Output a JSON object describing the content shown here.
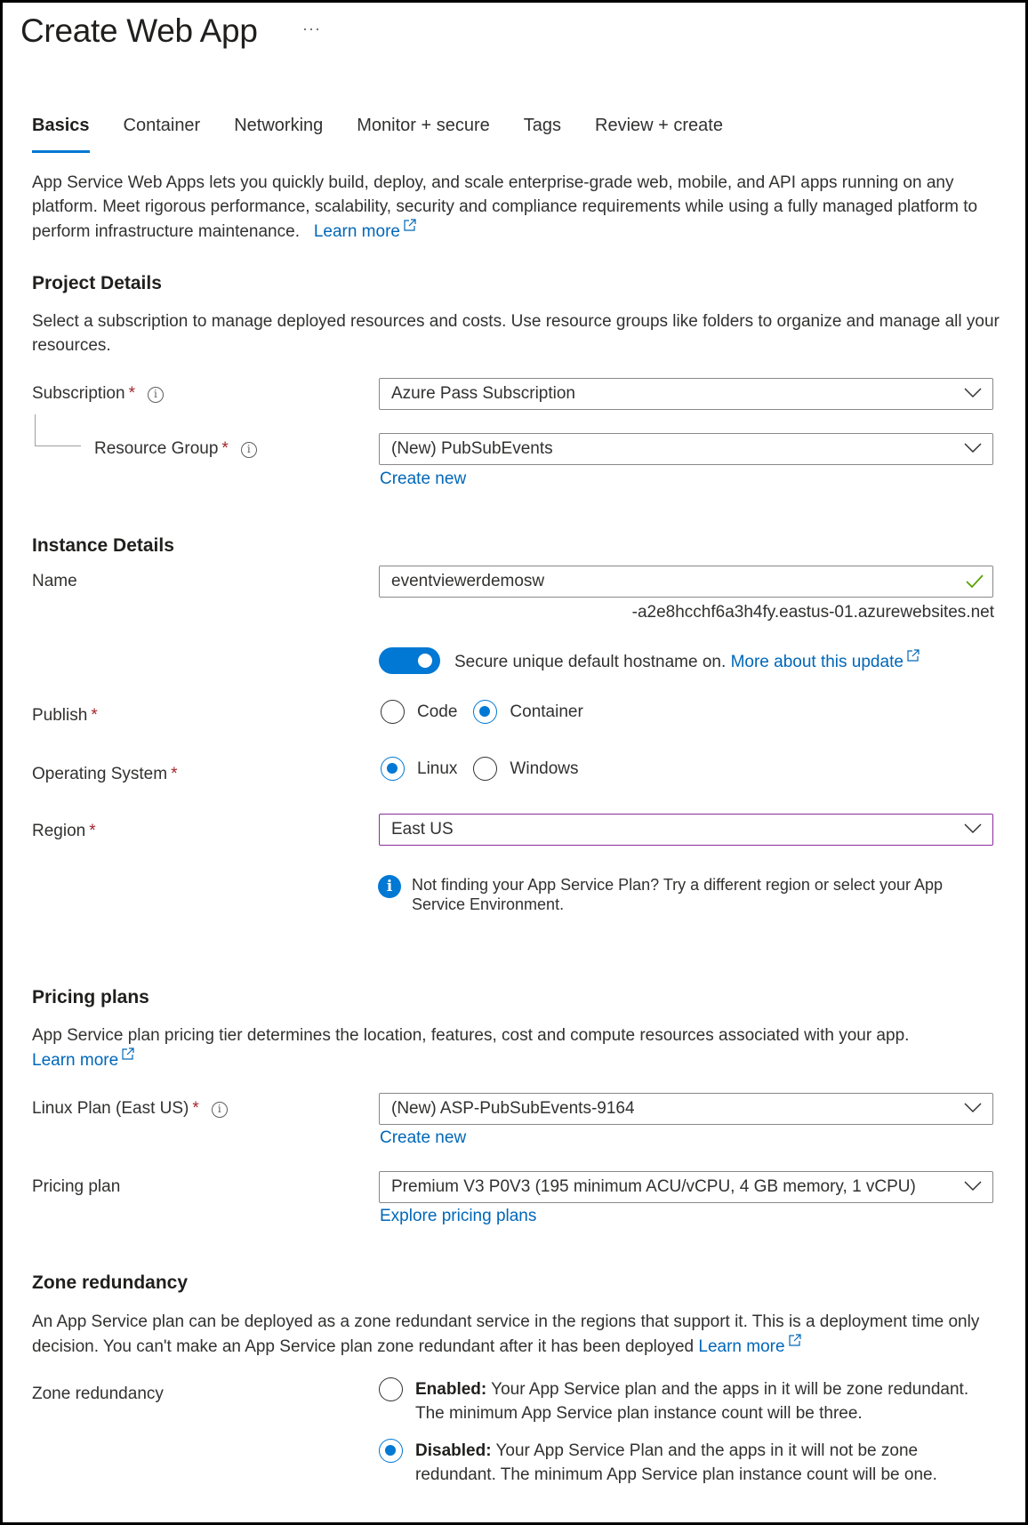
{
  "header": {
    "title": "Create Web App",
    "more_label": "···"
  },
  "tabs": [
    {
      "label": "Basics",
      "active": true
    },
    {
      "label": "Container",
      "active": false
    },
    {
      "label": "Networking",
      "active": false
    },
    {
      "label": "Monitor + secure",
      "active": false
    },
    {
      "label": "Tags",
      "active": false
    },
    {
      "label": "Review + create",
      "active": false
    }
  ],
  "intro": {
    "text": "App Service Web Apps lets you quickly build, deploy, and scale enterprise-grade web, mobile, and API apps running on any platform. Meet rigorous performance, scalability, security and compliance requirements while using a fully managed platform to perform infrastructure maintenance.",
    "learn_more": "Learn more"
  },
  "project_details": {
    "heading": "Project Details",
    "description": "Select a subscription to manage deployed resources and costs. Use resource groups like folders to organize and manage all your resources.",
    "subscription": {
      "label": "Subscription",
      "required": "*",
      "value": "Azure Pass Subscription"
    },
    "resource_group": {
      "label": "Resource Group",
      "required": "*",
      "value": "(New) PubSubEvents",
      "create_new": "Create new"
    }
  },
  "instance_details": {
    "heading": "Instance Details",
    "name": {
      "label": "Name",
      "value": "eventviewerdemosw",
      "hostname_suffix": "-a2e8hcchf6a3h4fy.eastus-01.azurewebsites.net"
    },
    "secure_hostname": {
      "enabled": true,
      "text": "Secure unique default hostname on.",
      "link": "More about this update"
    },
    "publish": {
      "label": "Publish",
      "required": "*",
      "options": [
        "Code",
        "Container"
      ],
      "selected": "Container"
    },
    "os": {
      "label": "Operating System",
      "required": "*",
      "options": [
        "Linux",
        "Windows"
      ],
      "selected": "Linux"
    },
    "region": {
      "label": "Region",
      "required": "*",
      "value": "East US"
    },
    "region_info": "Not finding your App Service Plan? Try a different region or select your App Service Environment."
  },
  "pricing_plans": {
    "heading": "Pricing plans",
    "description": "App Service plan pricing tier determines the location, features, cost and compute resources associated with your app.",
    "learn_more": "Learn more",
    "linux_plan": {
      "label": "Linux Plan (East US)",
      "required": "*",
      "value": "(New) ASP-PubSubEvents-9164",
      "create_new": "Create new"
    },
    "pricing_plan": {
      "label": "Pricing plan",
      "value": "Premium V3 P0V3 (195 minimum ACU/vCPU, 4 GB memory, 1 vCPU)",
      "explore": "Explore pricing plans"
    }
  },
  "zone_redundancy": {
    "heading": "Zone redundancy",
    "description": "An App Service plan can be deployed as a zone redundant service in the regions that support it. This is a deployment time only decision. You can't make an App Service plan zone redundant after it has been deployed",
    "learn_more": "Learn more",
    "label": "Zone redundancy",
    "options": [
      {
        "title": "Enabled:",
        "text": "Your App Service plan and the apps in it will be zone redundant. The minimum App Service plan instance count will be three.",
        "selected": false
      },
      {
        "title": "Disabled:",
        "text": "Your App Service Plan and the apps in it will not be zone redundant. The minimum App Service plan instance count will be one.",
        "selected": true
      }
    ]
  },
  "colors": {
    "accent": "#0078d4",
    "link": "#0067b8",
    "required": "#a4262c",
    "valid": "#57a300",
    "focus_border": "#8c2c9e"
  }
}
